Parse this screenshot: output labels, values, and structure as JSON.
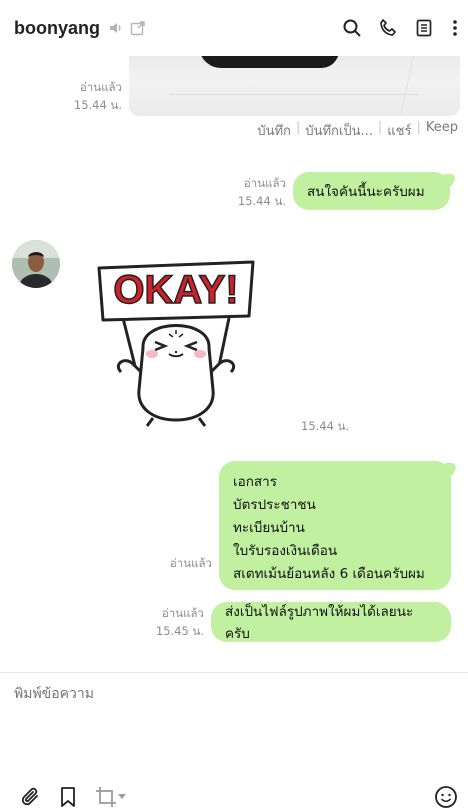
{
  "header": {
    "contact_name": "boonyang",
    "icons": [
      "speaker-icon",
      "external-link-icon",
      "search-icon",
      "phone-icon",
      "notes-icon",
      "more-vertical-icon"
    ]
  },
  "messages": {
    "photo_meta": {
      "read": "อ่านแล้ว",
      "time": "15.44 น."
    },
    "photo_actions": [
      "บันทึก",
      "บันทึกเป็น...",
      "แชร์",
      "Keep"
    ],
    "msg1": {
      "text": "สนใจคันนี้นะครับผม",
      "read": "อ่านแล้ว",
      "time": "15.44 น."
    },
    "sticker": {
      "text": "OKAY!",
      "time": "15.44 น."
    },
    "msg2": {
      "lines": [
        "เอกสาร",
        "บัตรประชาชน",
        "ทะเบียนบ้าน",
        "ใบรับรองเงินเดือน",
        "สเตทเม้นย้อนหลัง 6 เดือนครับผม"
      ],
      "read": "อ่านแล้ว"
    },
    "msg3": {
      "text": "ส่งเป็นไฟล์รูปภาพให้ผมได้เลยนะครับ",
      "read": "อ่านแล้ว",
      "time": "15.45 น."
    }
  },
  "composer": {
    "placeholder": "พิมพ์ข้อความ",
    "icons": [
      "attachment-icon",
      "bookmark-icon",
      "crop-icon",
      "dropdown-caret-icon",
      "emoji-icon"
    ]
  },
  "colors": {
    "bubble": "#c0f0a0",
    "meta_text": "#8c8c8c",
    "sticker_red": "#d0202a"
  }
}
